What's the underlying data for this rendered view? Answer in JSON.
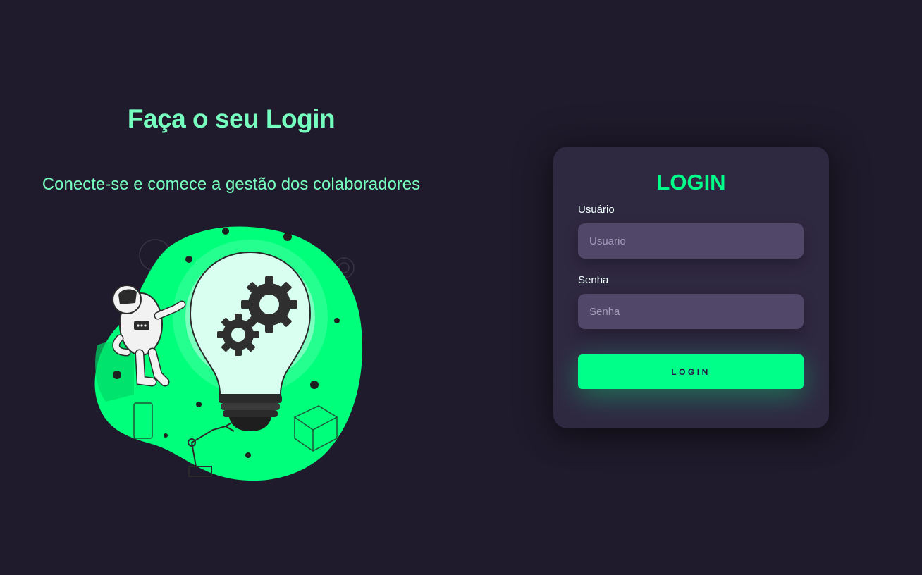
{
  "hero": {
    "title": "Faça o seu Login",
    "subtitle": "Conecte-se e comece a gestão dos colaboradores"
  },
  "login_card": {
    "title": "LOGIN",
    "username_label": "Usuário",
    "username_placeholder": "Usuario",
    "password_label": "Senha",
    "password_placeholder": "Senha",
    "submit_label": "LOGIN"
  },
  "colors": {
    "background": "#201b2c",
    "card": "#2f2841",
    "input": "#514869",
    "accent": "#00ff88",
    "heading": "#77ffc0"
  },
  "icons": {
    "illustration": "astronaut-lightbulb-gears-illustration"
  }
}
